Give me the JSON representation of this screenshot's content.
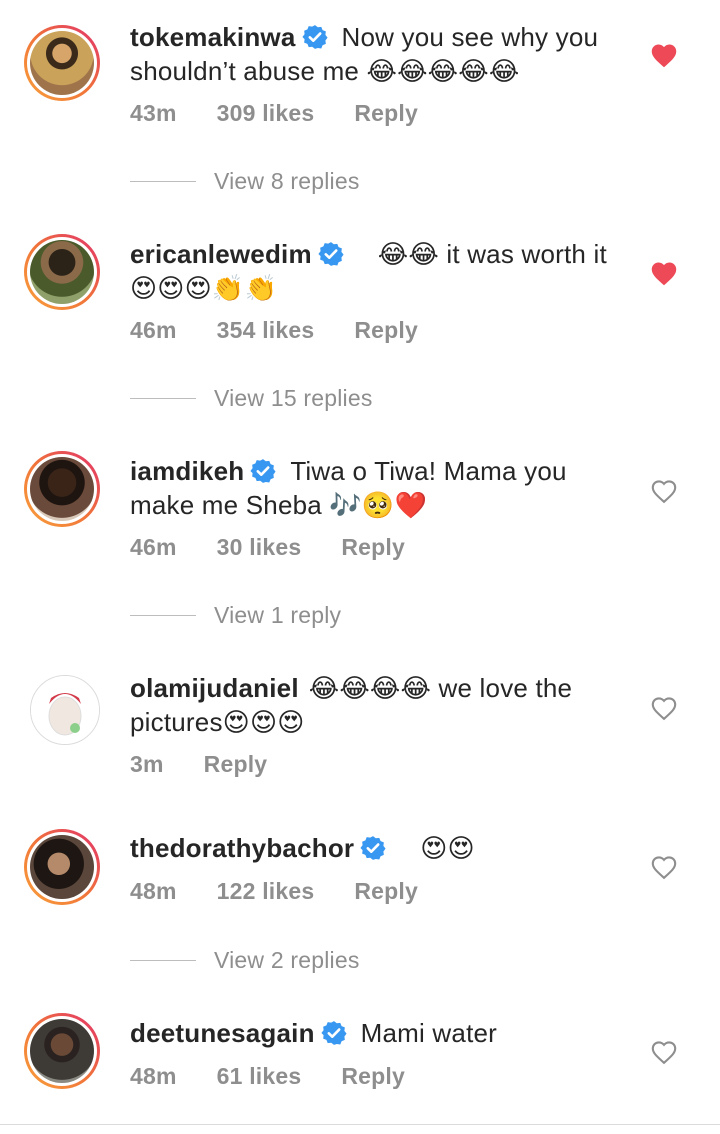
{
  "colors": {
    "heart_liked": "#ed4956",
    "heart_outline": "#8e8e8e",
    "verified": "#3897f0",
    "meta_text": "#8e8e8e"
  },
  "comments": [
    {
      "username": "tokemakinwa",
      "verified": true,
      "text": "Now you see why you shouldn’t abuse me 😂😂😂😂😂",
      "time": "43m",
      "likes": "309 likes",
      "reply_label": "Reply",
      "liked": true,
      "view_replies": "View 8 replies"
    },
    {
      "username": "ericanlewedim",
      "verified": true,
      "text": "😂😂 it was worth it 😍😍😍👏👏",
      "time": "46m",
      "likes": "354 likes",
      "reply_label": "Reply",
      "liked": true,
      "view_replies": "View 15 replies"
    },
    {
      "username": "iamdikeh",
      "verified": true,
      "text": "Tiwa o Tiwa! Mama you make me Sheba 🎶🥺❤️",
      "time": "46m",
      "likes": "30 likes",
      "reply_label": "Reply",
      "liked": false,
      "view_replies": "View 1 reply"
    },
    {
      "username": "olamijudaniel",
      "verified": false,
      "text": "😂😂😂😂 we love the pictures😍😍😍",
      "time": "3m",
      "likes": "",
      "reply_label": "Reply",
      "liked": false,
      "view_replies": ""
    },
    {
      "username": "thedorathybachor",
      "verified": true,
      "text": "😍😍",
      "time": "48m",
      "likes": "122 likes",
      "reply_label": "Reply",
      "liked": false,
      "view_replies": "View 2 replies"
    },
    {
      "username": "deetunesagain",
      "verified": true,
      "text": "Mami water",
      "time": "48m",
      "likes": "61 likes",
      "reply_label": "Reply",
      "liked": false,
      "view_replies": ""
    }
  ]
}
